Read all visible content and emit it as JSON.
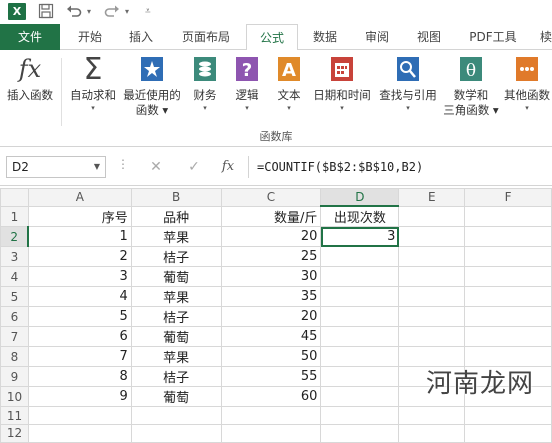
{
  "qat": {
    "app_icon": "X",
    "save_icon": "save-icon",
    "undo_icon": "undo-icon",
    "redo_icon": "redo-icon"
  },
  "tabs": [
    {
      "label": "文件"
    },
    {
      "label": "开始"
    },
    {
      "label": "插入"
    },
    {
      "label": "页面布局"
    },
    {
      "label": "公式"
    },
    {
      "label": "数据"
    },
    {
      "label": "审阅"
    },
    {
      "label": "视图"
    },
    {
      "label": "PDF工具"
    },
    {
      "label": "椟"
    }
  ],
  "ribbon": {
    "buttons": [
      {
        "label": "插入函数",
        "label2": "",
        "icon": "fx-icon"
      },
      {
        "label": "自动求和",
        "label2": "▾",
        "icon": "sigma-icon"
      },
      {
        "label": "最近使用的",
        "label2": "函数 ▾",
        "icon": "star-book-icon"
      },
      {
        "label": "财务",
        "label2": "▾",
        "icon": "finance-icon"
      },
      {
        "label": "逻辑",
        "label2": "▾",
        "icon": "logic-icon"
      },
      {
        "label": "文本",
        "label2": "▾",
        "icon": "text-icon"
      },
      {
        "label": "日期和时间",
        "label2": "▾",
        "icon": "calendar-icon"
      },
      {
        "label": "查找与引用",
        "label2": "▾",
        "icon": "lookup-icon"
      },
      {
        "label": "数学和",
        "label2": "三角函数 ▾",
        "icon": "theta-icon"
      },
      {
        "label": "其他函数",
        "label2": "▾",
        "icon": "more-functions-icon"
      }
    ],
    "group_label": "函数库",
    "colors": {
      "accent": "#217346",
      "blue": "#2f6db5",
      "teal": "#3c8a7b",
      "purple": "#8e55b0",
      "orange": "#e08a2a",
      "red": "#c8433a"
    }
  },
  "formula_bar": {
    "name_box": "D2",
    "cancel": "✕",
    "enter": "✓",
    "fx": "fx",
    "formula": "=COUNTIF($B$2:$B$10,B2)"
  },
  "sheet": {
    "columns": [
      "A",
      "B",
      "C",
      "D",
      "E",
      "F"
    ],
    "rows": [
      {
        "n": "1",
        "a": "序号",
        "b": "品种",
        "c": "数量/斤",
        "d": "出现次数"
      },
      {
        "n": "2",
        "a": "1",
        "b": "苹果",
        "c": "20",
        "d": "3"
      },
      {
        "n": "3",
        "a": "2",
        "b": "桔子",
        "c": "25",
        "d": ""
      },
      {
        "n": "4",
        "a": "3",
        "b": "葡萄",
        "c": "30",
        "d": ""
      },
      {
        "n": "5",
        "a": "4",
        "b": "苹果",
        "c": "35",
        "d": ""
      },
      {
        "n": "6",
        "a": "5",
        "b": "桔子",
        "c": "20",
        "d": ""
      },
      {
        "n": "7",
        "a": "6",
        "b": "葡萄",
        "c": "45",
        "d": ""
      },
      {
        "n": "8",
        "a": "7",
        "b": "苹果",
        "c": "50",
        "d": ""
      },
      {
        "n": "9",
        "a": "8",
        "b": "桔子",
        "c": "55",
        "d": ""
      },
      {
        "n": "10",
        "a": "9",
        "b": "葡萄",
        "c": "60",
        "d": ""
      },
      {
        "n": "11",
        "a": "",
        "b": "",
        "c": "",
        "d": ""
      },
      {
        "n": "12",
        "a": "",
        "b": "",
        "c": "",
        "d": ""
      }
    ]
  },
  "watermark": "河南龙网"
}
